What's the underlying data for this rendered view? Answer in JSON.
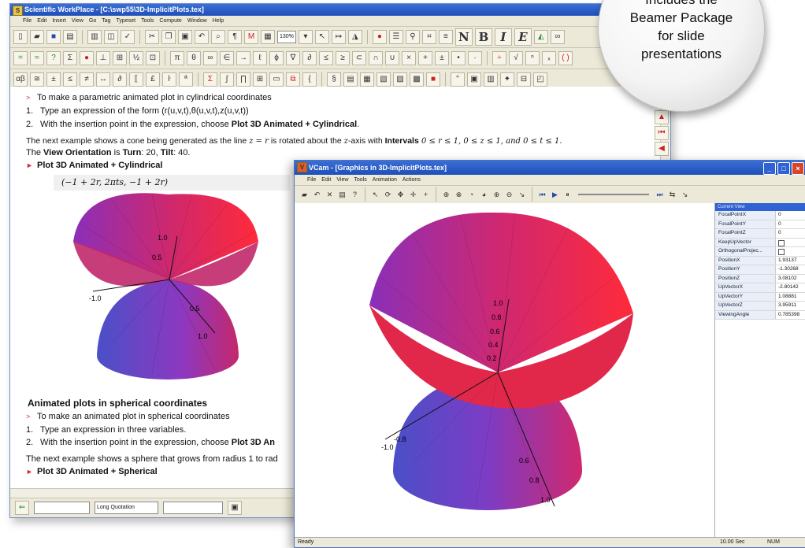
{
  "swp": {
    "title": "Scientific WorkPlace - [C:\\swp55\\3D-ImplicitPlots.tex]",
    "menu": [
      "File",
      "Edit",
      "Insert",
      "View",
      "Go",
      "Tag",
      "Typeset",
      "Tools",
      "Compute",
      "Window",
      "Help"
    ],
    "zoom": "130%",
    "text_buttons": {
      "n": "N",
      "b": "B",
      "i": "I",
      "e": "E"
    },
    "doc": {
      "l1": "To make a parametric animated plot in cylindrical coordinates",
      "s1_num": "1.",
      "s1": "Type an expression of the form (r(u,v,t),θ(u,v,t),z(u,v,t))",
      "s2_num": "2.",
      "s2a": "With the insertion point in the expression, choose ",
      "s2b": "Plot 3D Animated + Cylindrical",
      "s2c": ".",
      "p1a": "The next example shows a cone being generated as the line ",
      "p1m": "z = r",
      "p1b": " is rotated about the ",
      "p1m2": "z",
      "p1c": "-axis with ",
      "p1d": "Intervals",
      "p1e": " 0 ≤ r ≤ 1, 0 ≤ z ≤ 1, and 0 ≤ t ≤ 1.",
      "p2a": "The ",
      "p2b": "View Orientation",
      "p2c": " is ",
      "p2d": "Turn",
      "p2e": ": 20, ",
      "p2f": "Tilt",
      "p2g": ": 40.",
      "h1": "Plot 3D Animated + Cylindrical",
      "expr": "(−1 + 2r, 2πts, −1 + 2r)",
      "h2": "Animated plots in spherical coordinates",
      "l2": "To make an animated plot in spherical coordinates",
      "s3_num": "1.",
      "s3": "Type an expression in three variables.",
      "s4_num": "2.",
      "s4a": "With the insertion point in the expression, choose ",
      "s4b": "Plot 3D An",
      "p3": "The next example shows a sphere that grows from radius 1 to rad",
      "h3": "Plot 3D Animated + Spherical"
    },
    "plot_labels": [
      "1.0",
      "0.5",
      "-1.0",
      "0.5",
      "1.0"
    ],
    "status": {
      "combo2": "Long Quotation"
    }
  },
  "vcam": {
    "title": "VCam - [Graphics in 3D-ImplicitPlots.tex]",
    "menu": [
      "File",
      "Edit",
      "View",
      "Tools",
      "Animation",
      "Actions"
    ],
    "header": "Current View",
    "properties": [
      {
        "key": "FocalPointX",
        "value": "0"
      },
      {
        "key": "FocalPointY",
        "value": "0"
      },
      {
        "key": "FocalPointZ",
        "value": "0"
      },
      {
        "key": "KeepUpVector",
        "value": ""
      },
      {
        "key": "OrthogonalProjec...",
        "value": ""
      },
      {
        "key": "PositionX",
        "value": "1.93137"
      },
      {
        "key": "PositionY",
        "value": "-1.30268"
      },
      {
        "key": "PositionZ",
        "value": "3.08102"
      },
      {
        "key": "UpVectorX",
        "value": "-2.80142"
      },
      {
        "key": "UpVectorY",
        "value": "1.08881"
      },
      {
        "key": "UpVectorZ",
        "value": "3.95911"
      },
      {
        "key": "ViewingAngle",
        "value": "0.785398"
      }
    ],
    "plot_labels": [
      "1.0",
      "0.8",
      "0.6",
      "0.4",
      "0.2",
      "-0.8",
      "-1.0",
      "0.6",
      "0.8",
      "1.0"
    ],
    "status": {
      "left": "Ready",
      "time": "10.00 Sec",
      "num": "NUM"
    }
  },
  "callout": {
    "line1": "Includes the",
    "line2": "Beamer Package",
    "line3": "for slide",
    "line4": "presentations"
  }
}
